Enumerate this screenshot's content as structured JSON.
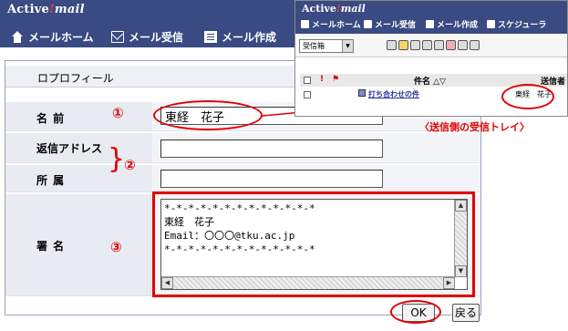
{
  "app": {
    "logo_main": "Active",
    "logo_excl": "!",
    "logo_mail": "mail"
  },
  "nav": {
    "home": "メールホーム",
    "receive": "メール受信",
    "compose": "メール作成"
  },
  "profile": {
    "section_title": "ロプロフィール",
    "name_label": "名 前",
    "name_value": "東経　花子",
    "reply_label": "返信アドレス",
    "reply_value": "",
    "affiliation_label": "所 属",
    "affiliation_value": "",
    "signature_label": "署 名",
    "signature_text": "*-*-*-*-*-*-*-*-*-*-*-*-*\n東経　花子\nEmail：〇〇〇@tku.ac.jp\n*-*-*-*-*-*-*-*-*-*-*-*-*"
  },
  "buttons": {
    "ok": "OK",
    "back": "戻る"
  },
  "annotations": {
    "n1": "①",
    "n2": "②",
    "n3": "③",
    "brace": "}",
    "tray_caption": "〈送信側の受信トレイ〉",
    "color": "#e00000"
  },
  "inset": {
    "logo_main": "Active",
    "logo_excl": "!",
    "logo_mail": "mail",
    "nav": [
      "メールホーム",
      "メール受信",
      "メール作成",
      "スケジューラ"
    ],
    "folder": "受信箱",
    "col_subject": "件名",
    "col_sender": "送信者",
    "row_subject": "打ち合わせの件",
    "row_sender": "東経　花子",
    "flag_mark": "!"
  },
  "colors": {
    "header_bg": "#3a4a82",
    "accent_red": "#e00000"
  }
}
